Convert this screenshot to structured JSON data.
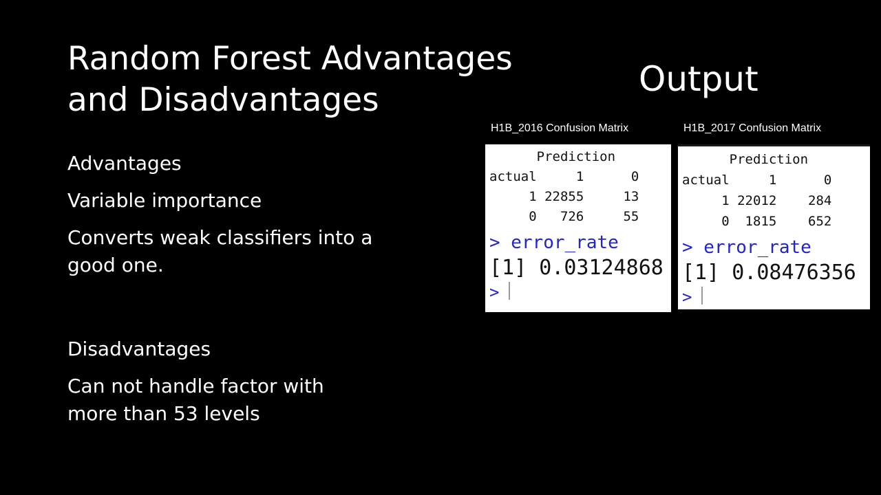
{
  "slide": {
    "title": "Random Forest Advantages\nand Disadvantages",
    "output_title": "Output"
  },
  "content": {
    "advantages_heading": "Advantages",
    "advantages": [
      "Variable importance",
      "Converts weak classifiers into a good one."
    ],
    "disadvantages_heading": "Disadvantages",
    "disadvantages": [
      "Can not handle factor with more than 53 levels"
    ]
  },
  "panels": [
    {
      "header": "H1B_2016 Confusion Matrix",
      "rows": [
        "      Prediction",
        "actual     1      0",
        "     1 22855     13",
        "     0   726     55"
      ],
      "error_cmd": "> error_rate",
      "error_value": "[1] 0.03124868",
      "prompt": ">"
    },
    {
      "header": "H1B_2017 Confusion Matrix",
      "rows": [
        "      Prediction",
        "actual     1      0",
        "     1 22012    284",
        "     0  1815    652"
      ],
      "error_cmd": "> error_rate",
      "error_value": "[1] 0.08476356",
      "prompt": ">"
    }
  ]
}
